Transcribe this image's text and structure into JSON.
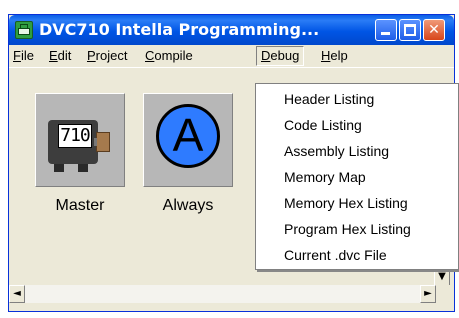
{
  "window": {
    "title": "DVC710 Intella Programming...",
    "controls": {
      "minimize": "minimize",
      "maximize": "maximize",
      "close": "✕"
    }
  },
  "menubar": {
    "items": [
      {
        "label_prefix": "",
        "mnemonic": "F",
        "label_rest": "ile"
      },
      {
        "label_prefix": "",
        "mnemonic": "E",
        "label_rest": "dit"
      },
      {
        "label_prefix": "",
        "mnemonic": "P",
        "label_rest": "roject"
      },
      {
        "label_prefix": "",
        "mnemonic": "C",
        "label_rest": "ompile"
      },
      {
        "label_prefix": "",
        "mnemonic": "D",
        "label_rest": "ebug"
      },
      {
        "label_prefix": "",
        "mnemonic": "H",
        "label_rest": "elp"
      }
    ],
    "active": "Debug"
  },
  "tiles": [
    {
      "label": "Master",
      "display": "710",
      "icon": "device-icon"
    },
    {
      "label": "Always",
      "display": "A",
      "icon": "always-circle-icon"
    }
  ],
  "debug_menu": {
    "items": [
      "Header Listing",
      "Code Listing",
      "Assembly Listing",
      "Memory Map",
      "Memory Hex Listing",
      "Program Hex Listing",
      "Current .dvc File"
    ]
  },
  "scrollbar": {
    "left_arrow": "◄",
    "right_arrow": "►",
    "down_arrow": "▼"
  },
  "colors": {
    "titlebar": "#0055e5",
    "menu_bg": "#ece9d8",
    "tile_bg": "#b7b7b7",
    "always_circle": "#2e7bff"
  }
}
